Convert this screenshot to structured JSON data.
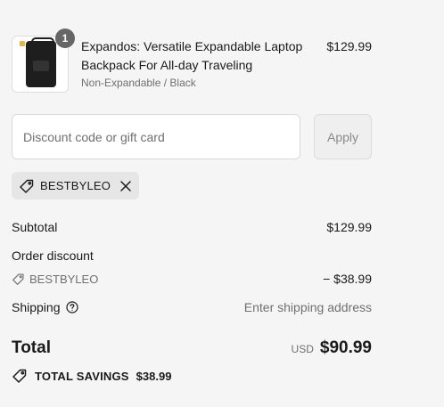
{
  "line_item": {
    "quantity": "1",
    "name": "Expandos: Versatile Expandable Laptop Backpack For All-day Traveling",
    "variant": "Non-Expandable / Black",
    "price": "$129.99"
  },
  "discount": {
    "placeholder": "Discount code or gift card",
    "apply_label": "Apply",
    "applied_code": "BESTBYLEO"
  },
  "summary": {
    "subtotal_label": "Subtotal",
    "subtotal_value": "$129.99",
    "order_discount_label": "Order discount",
    "discount_code": "BESTBYLEO",
    "discount_value": "− $38.99",
    "shipping_label": "Shipping",
    "shipping_value": "Enter shipping address",
    "total_label": "Total",
    "currency": "USD",
    "total_value": "$90.99",
    "savings_label": "TOTAL SAVINGS",
    "savings_value": "$38.99"
  },
  "icons": {
    "tag": "tag-icon",
    "close": "close-icon",
    "help": "help-circle-icon"
  }
}
